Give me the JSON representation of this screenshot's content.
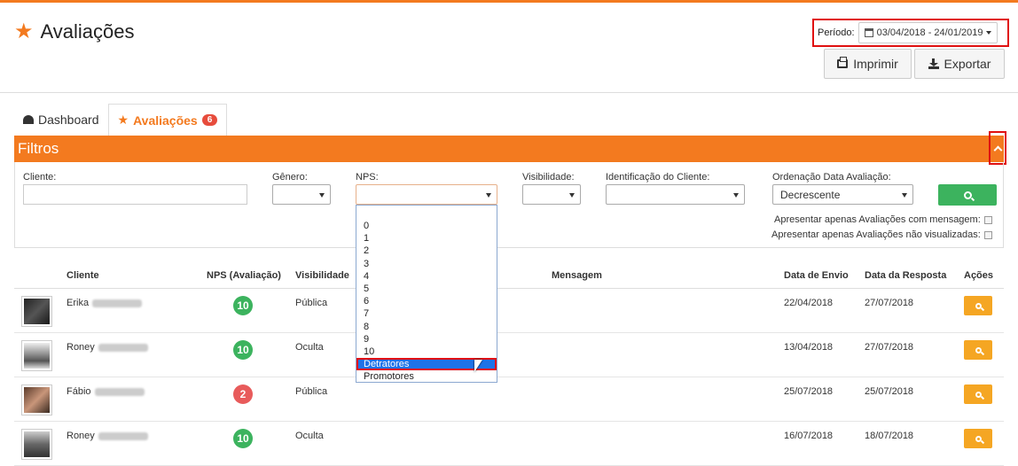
{
  "header": {
    "title": "Avaliações",
    "period_label": "Período:",
    "period_value": "03/04/2018 - 24/01/2019",
    "print_label": "Imprimir",
    "export_label": "Exportar"
  },
  "tabs": [
    {
      "label": "Dashboard",
      "icon": "dashboard-icon"
    },
    {
      "label": "Avaliações",
      "icon": "star-icon",
      "badge": "6"
    }
  ],
  "filters": {
    "title": "Filtros",
    "cliente_label": "Cliente:",
    "genero_label": "Gênero:",
    "nps_label": "NPS:",
    "visibilidade_label": "Visibilidade:",
    "identificacao_label": "Identificação do Cliente:",
    "ordenacao_label": "Ordenação Data Avaliação:",
    "ordenacao_value": "Decrescente",
    "check_mensagem": "Apresentar apenas Avaliações com mensagem:",
    "check_nao_visualizadas": "Apresentar apenas Avaliações não visualizadas:"
  },
  "nps_options": [
    "",
    "0",
    "1",
    "2",
    "3",
    "4",
    "5",
    "6",
    "7",
    "8",
    "9",
    "10",
    "Detratores",
    "Promotores"
  ],
  "nps_highlighted": "Detratores",
  "table": {
    "columns": {
      "cliente": "Cliente",
      "nps": "NPS (Avaliação)",
      "visibilidade": "Visibilidade",
      "mensagem": "Mensagem",
      "envio": "Data de Envio",
      "resposta": "Data da Resposta",
      "acoes": "Ações"
    },
    "rows": [
      {
        "cliente": "Erika",
        "nps": "10",
        "visibilidade": "Pública",
        "envio": "22/04/2018",
        "resposta": "27/07/2018"
      },
      {
        "cliente": "Roney",
        "nps": "10",
        "visibilidade": "Oculta",
        "envio": "13/04/2018",
        "resposta": "27/07/2018"
      },
      {
        "cliente": "Fábio",
        "nps": "2",
        "visibilidade": "Pública",
        "envio": "25/07/2018",
        "resposta": "25/07/2018"
      },
      {
        "cliente": "Roney",
        "nps": "10",
        "visibilidade": "Oculta",
        "envio": "16/07/2018",
        "resposta": "18/07/2018"
      }
    ]
  },
  "colors": {
    "accent": "#f37a1f",
    "success": "#3cb35e",
    "danger": "#e85b5b",
    "warning": "#f5a623"
  }
}
